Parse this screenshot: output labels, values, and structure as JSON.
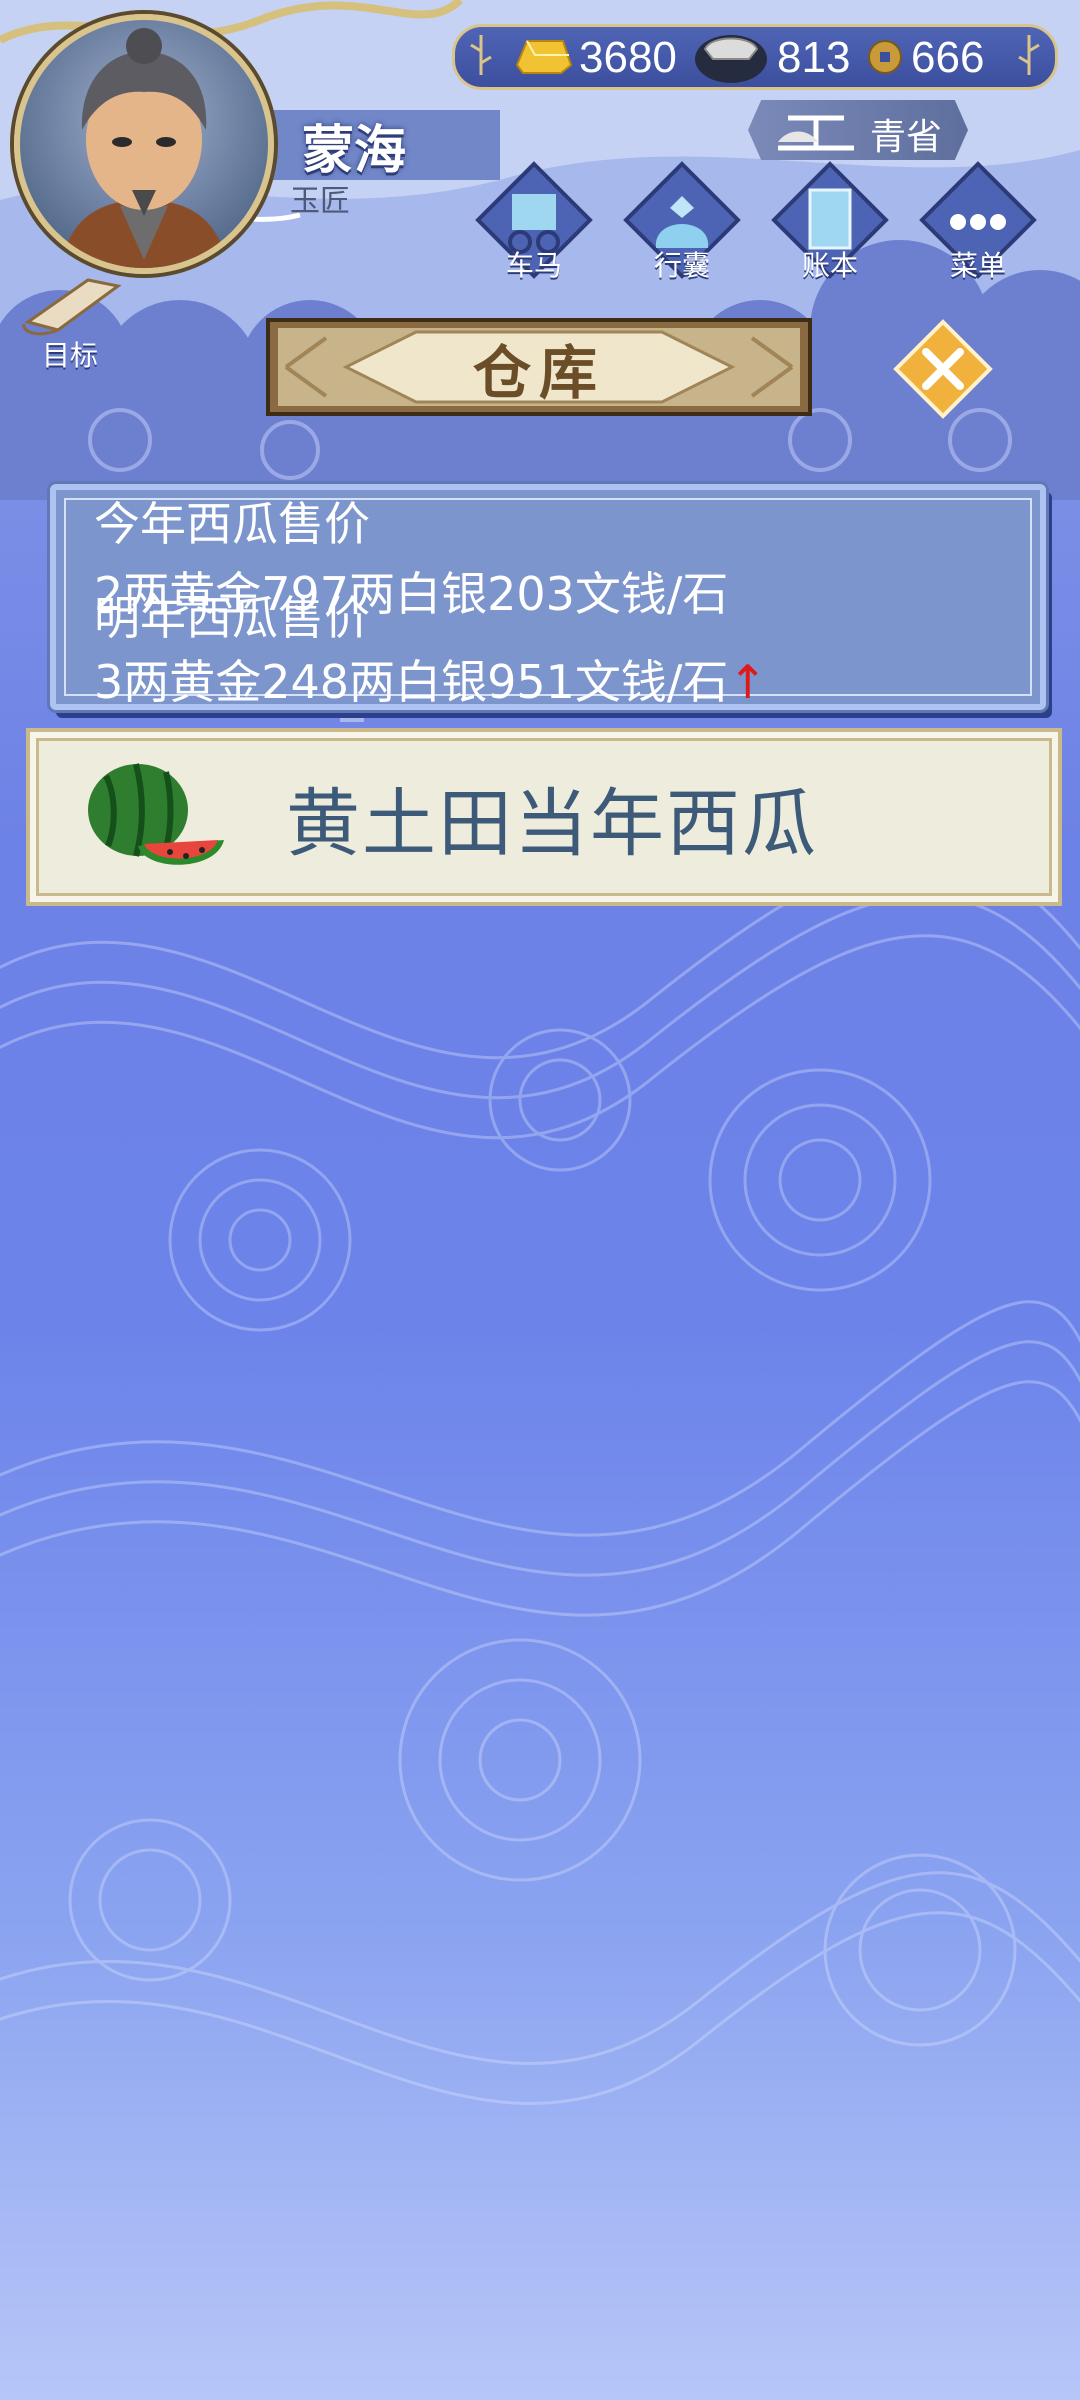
{
  "player": {
    "name": "蒙海",
    "title": "玉匠"
  },
  "currency": {
    "gold": "3680",
    "silver": "813",
    "copper": "666"
  },
  "region": "青省",
  "nav": [
    {
      "label": "车马",
      "icon": "carriage-icon"
    },
    {
      "label": "行囊",
      "icon": "bundle-icon"
    },
    {
      "label": "账本",
      "icon": "ledger-icon"
    },
    {
      "label": "菜单",
      "icon": "more-icon"
    }
  ],
  "goal_label": "目标",
  "page_title": "仓库",
  "price": {
    "this_year_heading": "今年西瓜售价",
    "this_year_value": "2两黄金797两白银203文钱/石",
    "next_year_heading": "明年西瓜售价",
    "next_year_value": "3两黄金248两白银951文钱/石",
    "trend_arrow": "↑"
  },
  "item": {
    "name": "黄土田当年西瓜",
    "icon": "watermelon-icon"
  }
}
